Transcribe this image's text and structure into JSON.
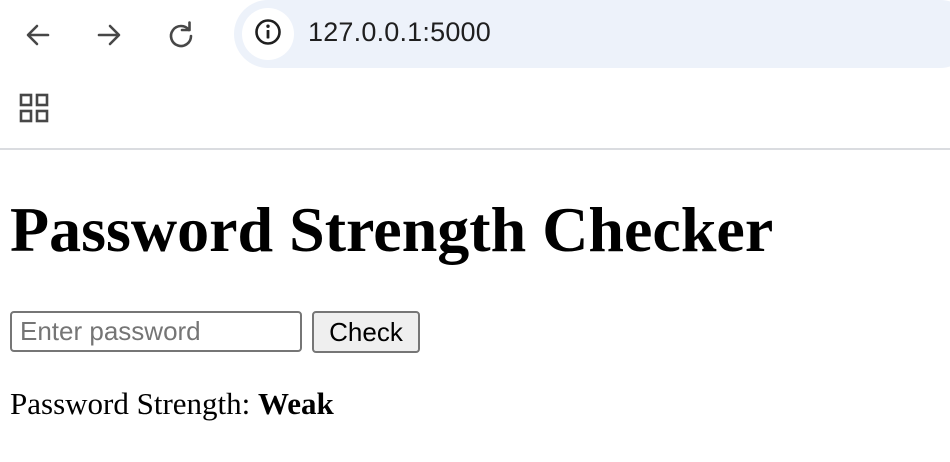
{
  "browser": {
    "url": "127.0.0.1:5000",
    "icons": {
      "back": "arrow-left-icon",
      "forward": "arrow-right-icon",
      "reload": "reload-icon",
      "site_info": "info-icon",
      "apps": "apps-grid-icon"
    },
    "omnibox_color": "#edf2fa"
  },
  "page": {
    "title": "Password Strength Checker",
    "input_placeholder": "Enter password",
    "input_value": "",
    "button_label": "Check",
    "result_label": "Password Strength:",
    "result_value": "Weak"
  }
}
